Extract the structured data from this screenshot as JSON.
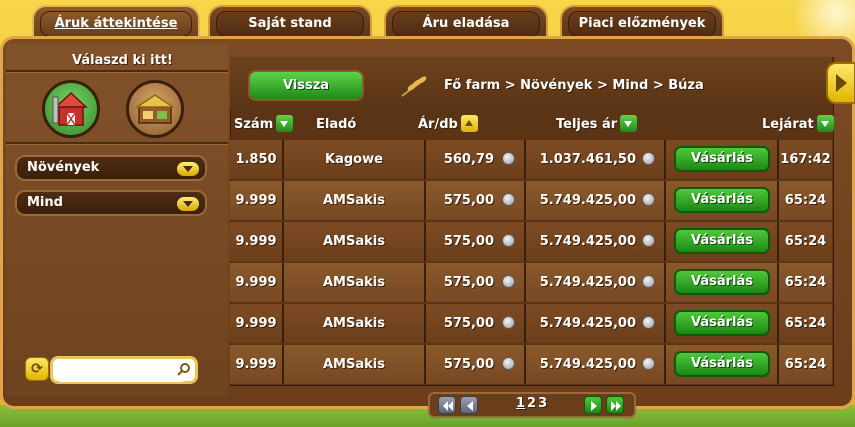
{
  "tabs": [
    {
      "label": "Áruk áttekintése",
      "active": true
    },
    {
      "label": "Saját stand",
      "active": false
    },
    {
      "label": "Áru eladása",
      "active": false
    },
    {
      "label": "Piaci előzmények",
      "active": false
    }
  ],
  "sidebar": {
    "pick_label": "Válaszd ki itt!",
    "icons": [
      "farm-icon",
      "shop-icon"
    ],
    "category_select": "Növények",
    "subcategory_select": "Mind",
    "search_placeholder": ""
  },
  "topbar": {
    "back_label": "Vissza",
    "breadcrumb": "Fő farm > Növények > Mind > Búza"
  },
  "table": {
    "headers": {
      "szam": "Szám",
      "elado": "Eladó",
      "ar": "Ár/db",
      "teljes": "Teljes ár",
      "lejarat": "Lejárat"
    },
    "buy_label": "Vásárlás",
    "rows": [
      {
        "szam": "1.850",
        "elado": "Kagowe",
        "ar": "560,79",
        "teljes": "1.037.461,50",
        "lejarat": "167:42"
      },
      {
        "szam": "9.999",
        "elado": "AMSakis",
        "ar": "575,00",
        "teljes": "5.749.425,00",
        "lejarat": "65:24"
      },
      {
        "szam": "9.999",
        "elado": "AMSakis",
        "ar": "575,00",
        "teljes": "5.749.425,00",
        "lejarat": "65:24"
      },
      {
        "szam": "9.999",
        "elado": "AMSakis",
        "ar": "575,00",
        "teljes": "5.749.425,00",
        "lejarat": "65:24"
      },
      {
        "szam": "9.999",
        "elado": "AMSakis",
        "ar": "575,00",
        "teljes": "5.749.425,00",
        "lejarat": "65:24"
      },
      {
        "szam": "9.999",
        "elado": "AMSakis",
        "ar": "575,00",
        "teljes": "5.749.425,00",
        "lejarat": "65:24"
      }
    ]
  },
  "pagination": {
    "pages": [
      "1",
      "2",
      "3"
    ],
    "current": "1"
  },
  "colors": {
    "accent_green": "#2fa024",
    "gold": "#e0a54a",
    "wood": "#6b3d1a"
  }
}
